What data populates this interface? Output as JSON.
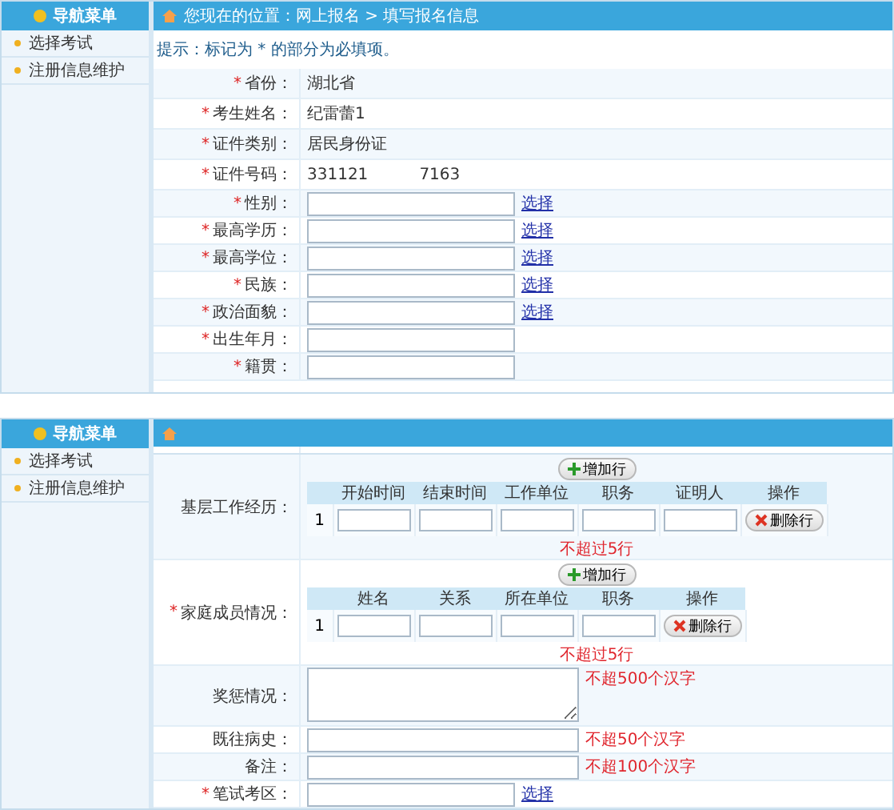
{
  "panels": [
    {
      "nav": {
        "title": "导航菜单",
        "items": [
          "选择考试",
          "注册信息维护"
        ]
      },
      "breadcrumb": "您现在的位置：网上报名 > 填写报名信息",
      "tip": "提示：标记为 * 的部分为必填项。",
      "fields": [
        {
          "kind": "text",
          "mark": "*",
          "label": "省份：",
          "values": [
            "湖北省"
          ]
        },
        {
          "kind": "text",
          "mark": "*",
          "label": "考生姓名：",
          "values": [
            "纪雷蕾1"
          ]
        },
        {
          "kind": "text",
          "mark": "*",
          "label": "证件类别：",
          "values": [
            "居民身份证"
          ]
        },
        {
          "kind": "text",
          "mark": "*",
          "label": "证件号码：",
          "values": [
            "331121",
            "7163"
          ]
        },
        {
          "kind": "input",
          "mark": "*",
          "label": "性别：",
          "link": "选择"
        },
        {
          "kind": "input",
          "mark": "*",
          "label": "最高学历：",
          "link": "选择"
        },
        {
          "kind": "input",
          "mark": "*",
          "label": "最高学位：",
          "link": "选择"
        },
        {
          "kind": "input",
          "mark": "*",
          "label": "民族：",
          "link": "选择"
        },
        {
          "kind": "input",
          "mark": "*",
          "label": "政治面貌：",
          "link": "选择"
        },
        {
          "kind": "input",
          "mark": "*",
          "label": "出生年月："
        },
        {
          "kind": "input",
          "mark": "*",
          "label": "籍贯："
        }
      ]
    },
    {
      "nav": {
        "title": "导航菜单",
        "items": [
          "选择考试",
          "注册信息维护"
        ]
      },
      "fields": [
        {
          "kind": "table",
          "label": "基层工作经历：",
          "add_button": "增加行",
          "columns": [
            "开始时间",
            "结束时间",
            "工作单位",
            "职务",
            "证明人",
            "操作"
          ],
          "rows": [
            {
              "number": "1",
              "delete_button": "删除行"
            }
          ],
          "note": "不超过5行"
        },
        {
          "kind": "table",
          "mark": "*",
          "label": "家庭成员情况：",
          "add_button": "增加行",
          "columns": [
            "姓名",
            "关系",
            "所在单位",
            "职务",
            "操作"
          ],
          "rows": [
            {
              "number": "1",
              "delete_button": "删除行"
            }
          ],
          "note": "不超过5行"
        },
        {
          "kind": "textarea",
          "label": "奖惩情况：",
          "note": "不超500个汉字"
        },
        {
          "kind": "input",
          "label": "既往病史：",
          "note": "不超50个汉字"
        },
        {
          "kind": "input",
          "label": "备注：",
          "note": "不超100个汉字"
        },
        {
          "kind": "input",
          "mark": "*",
          "label": "笔试考区：",
          "link": "选择"
        }
      ]
    }
  ]
}
